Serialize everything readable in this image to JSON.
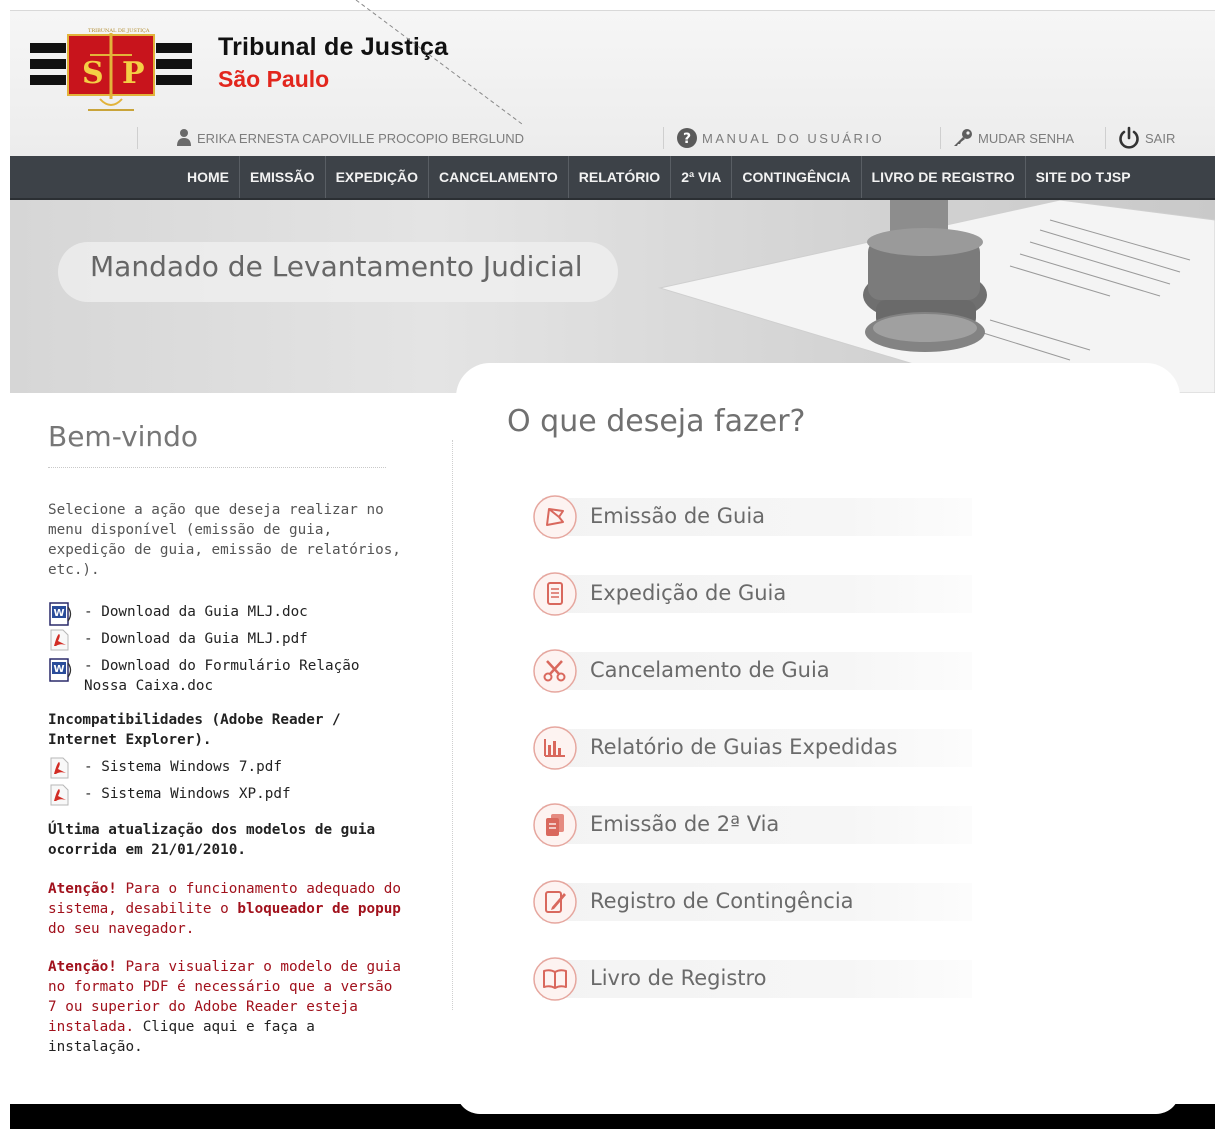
{
  "header": {
    "logo_title": "Tribunal de Justiça",
    "logo_subtitle": "São Paulo",
    "logo_seal_text": "TRIBUNAL DE JUSTIÇA",
    "logo_emblem_left": "S",
    "logo_emblem_right": "P",
    "user_name": "ERIKA ERNESTA CAPOVILLE PROCOPIO BERGLUND",
    "manual_label": "MANUAL DO USUÁRIO",
    "change_password_label": "MUDAR SENHA",
    "logout_label": "SAIR"
  },
  "nav": {
    "items": [
      "HOME",
      "EMISSÃO",
      "EXPEDIÇÃO",
      "CANCELAMENTO",
      "RELATÓRIO",
      "2ª VIA",
      "CONTINGÊNCIA",
      "LIVRO DE REGISTRO",
      "SITE DO TJSP"
    ]
  },
  "banner": {
    "title": "Mandado de Levantamento Judicial"
  },
  "left": {
    "welcome": "Bem-vindo",
    "intro": "Selecione a ação que deseja realizar no menu disponível (emissão de guia, expedição de guia, emissão de relatórios, etc.).",
    "downloads": [
      {
        "label": "- Download da Guia MLJ.doc",
        "icon": "word-doc-icon"
      },
      {
        "label": "- Download da Guia MLJ.pdf",
        "icon": "pdf-icon"
      },
      {
        "label": "- Download do Formulário Relação Nossa Caixa.doc",
        "icon": "word-doc-icon"
      }
    ],
    "incompat_title": "Incompatibilidades (Adobe Reader / Internet Explorer).",
    "incompat_items": [
      {
        "label": "- Sistema Windows 7.pdf",
        "icon": "pdf-icon"
      },
      {
        "label": "- Sistema Windows XP.pdf",
        "icon": "pdf-icon"
      }
    ],
    "last_update": "Última atualização dos modelos de guia ocorrida em 21/01/2010.",
    "warning1": {
      "strong": "Atenção!",
      "text1": " Para o funcionamento adequado do sistema, desabilite o ",
      "strong2": "bloqueador de popup",
      "text2": " do seu navegador."
    },
    "warning2": {
      "strong": "Atenção!",
      "text1": " Para visualizar o modelo de guia no formato PDF é necessário que a versão 7 ou superior do Adobe Reader esteja instalada. ",
      "link": "Clique aqui e faça a instalação."
    }
  },
  "main": {
    "question": "O que deseja fazer?",
    "actions": [
      {
        "label": "Emissão de Guia",
        "icon": "emission-icon"
      },
      {
        "label": "Expedição de Guia",
        "icon": "document-icon"
      },
      {
        "label": "Cancelamento de Guia",
        "icon": "scissors-icon"
      },
      {
        "label": "Relatório de Guias Expedidas",
        "icon": "bar-chart-icon"
      },
      {
        "label": "Emissão de 2ª Via",
        "icon": "copy-icon"
      },
      {
        "label": "Registro de Contingência",
        "icon": "edit-note-icon"
      },
      {
        "label": "Livro de Registro",
        "icon": "book-icon"
      }
    ]
  },
  "colors": {
    "navbar": "#3d4248",
    "accent_red": "#e2261d",
    "warning_red": "#a1111c",
    "action_icon": "#d9685d"
  }
}
